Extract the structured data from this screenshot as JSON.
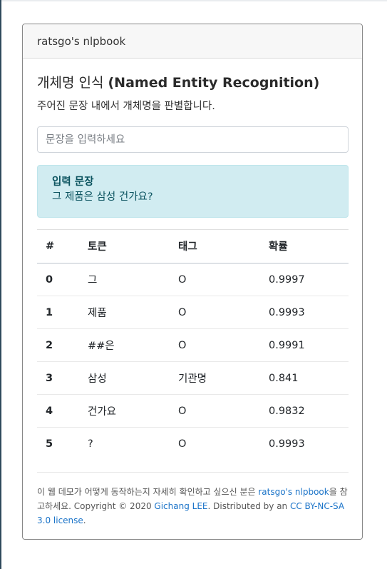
{
  "card": {
    "header": "ratsgo's nlpbook"
  },
  "page": {
    "title_ko": "개체명 인식",
    "title_en": "(Named Entity Recognition)",
    "description": "주어진 문장 내에서 개체명을 판별합니다."
  },
  "input": {
    "placeholder": "문장을 입력하세요",
    "value": ""
  },
  "alert": {
    "heading": "입력 문장",
    "sentence": "그 제품은 삼성 건가요?"
  },
  "table": {
    "headers": [
      "#",
      "토큰",
      "태그",
      "확률"
    ],
    "rows": [
      {
        "idx": "0",
        "token": "그",
        "tag": "O",
        "prob": "0.9997"
      },
      {
        "idx": "1",
        "token": "제품",
        "tag": "O",
        "prob": "0.9993"
      },
      {
        "idx": "2",
        "token": "##은",
        "tag": "O",
        "prob": "0.9991"
      },
      {
        "idx": "3",
        "token": "삼성",
        "tag": "기관명",
        "prob": "0.841"
      },
      {
        "idx": "4",
        "token": "건가요",
        "tag": "O",
        "prob": "0.9832"
      },
      {
        "idx": "5",
        "token": "?",
        "tag": "O",
        "prob": "0.9993"
      }
    ]
  },
  "footer": {
    "text1": "이 웹 데모가 어떻게 동작하는지 자세히 확인하고 싶으신 분은 ",
    "link1": "ratsgo's nlpbook",
    "text2": "을 참고하세요. Copyright © 2020 ",
    "link2": "Gichang LEE",
    "text3": ". Distributed by an ",
    "link3": "CC BY-NC-SA 3.0 license",
    "text4": "."
  },
  "colors": {
    "alert_bg": "#d1ecf1",
    "alert_text": "#0c5460",
    "link": "#1a73c8"
  }
}
